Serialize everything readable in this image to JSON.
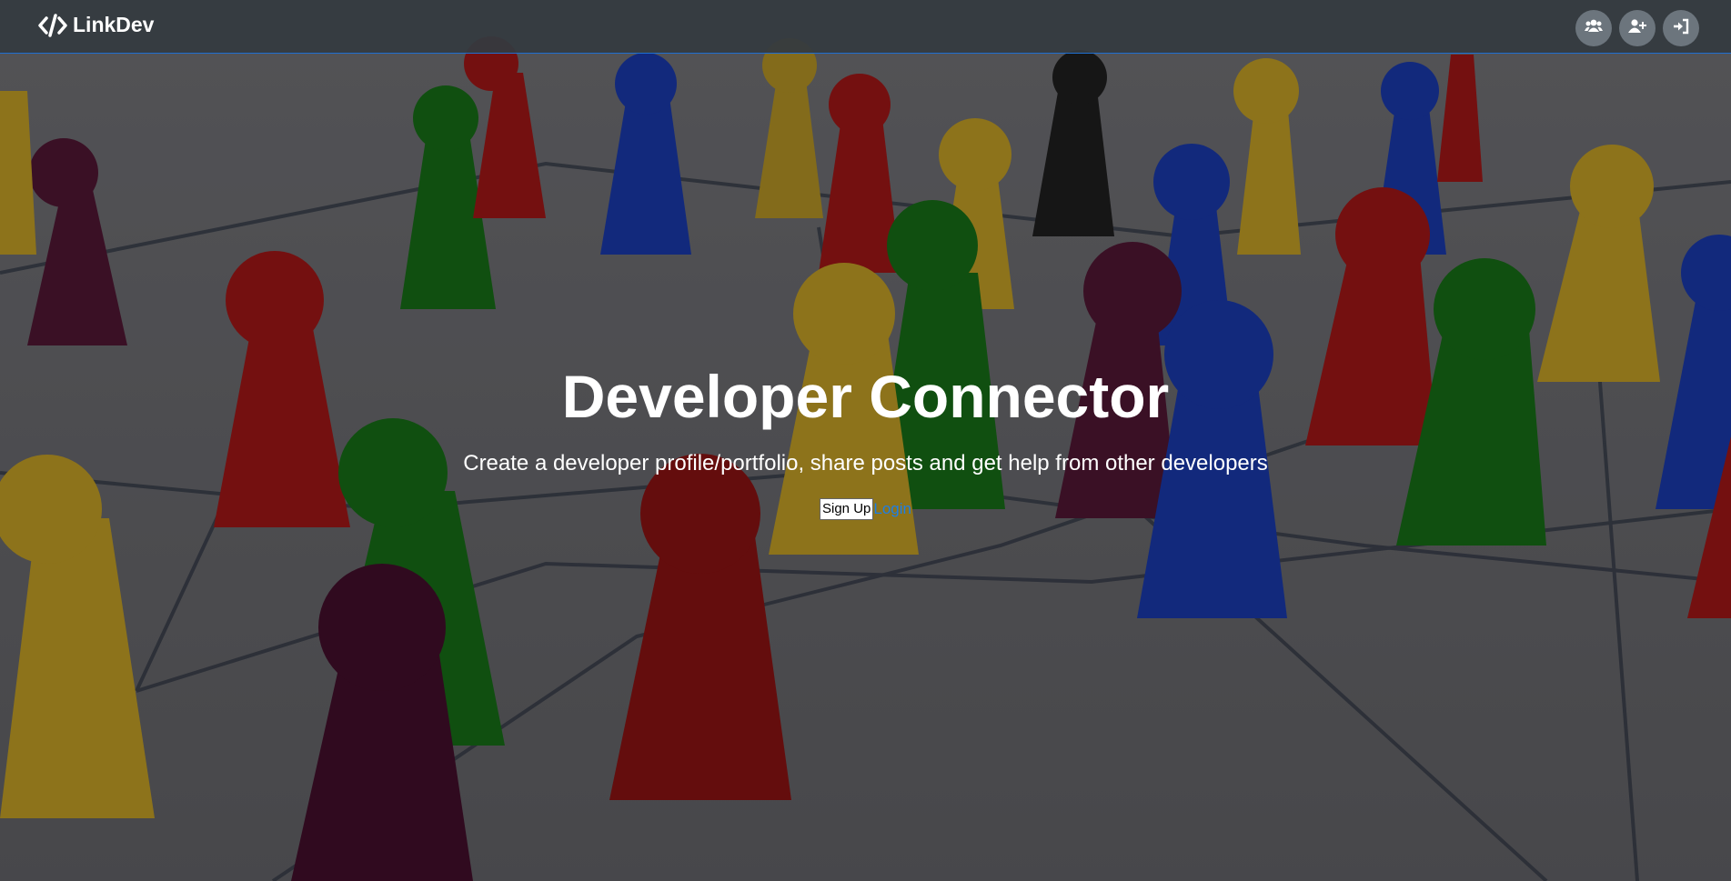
{
  "navbar": {
    "brand_label": "LinkDev",
    "icons": [
      "users-icon",
      "user-plus-icon",
      "sign-in-icon"
    ]
  },
  "hero": {
    "title": "Developer Connector",
    "subtitle": "Create a developer profile/portfolio, share posts and get help from other developers",
    "signup_label": "Sign Up",
    "login_label": "Login"
  },
  "colors": {
    "navbar_bg": "#343a40",
    "navbar_border": "#1f6fd1",
    "link": "#1c7ee6",
    "icon_button": "#6c757d"
  }
}
